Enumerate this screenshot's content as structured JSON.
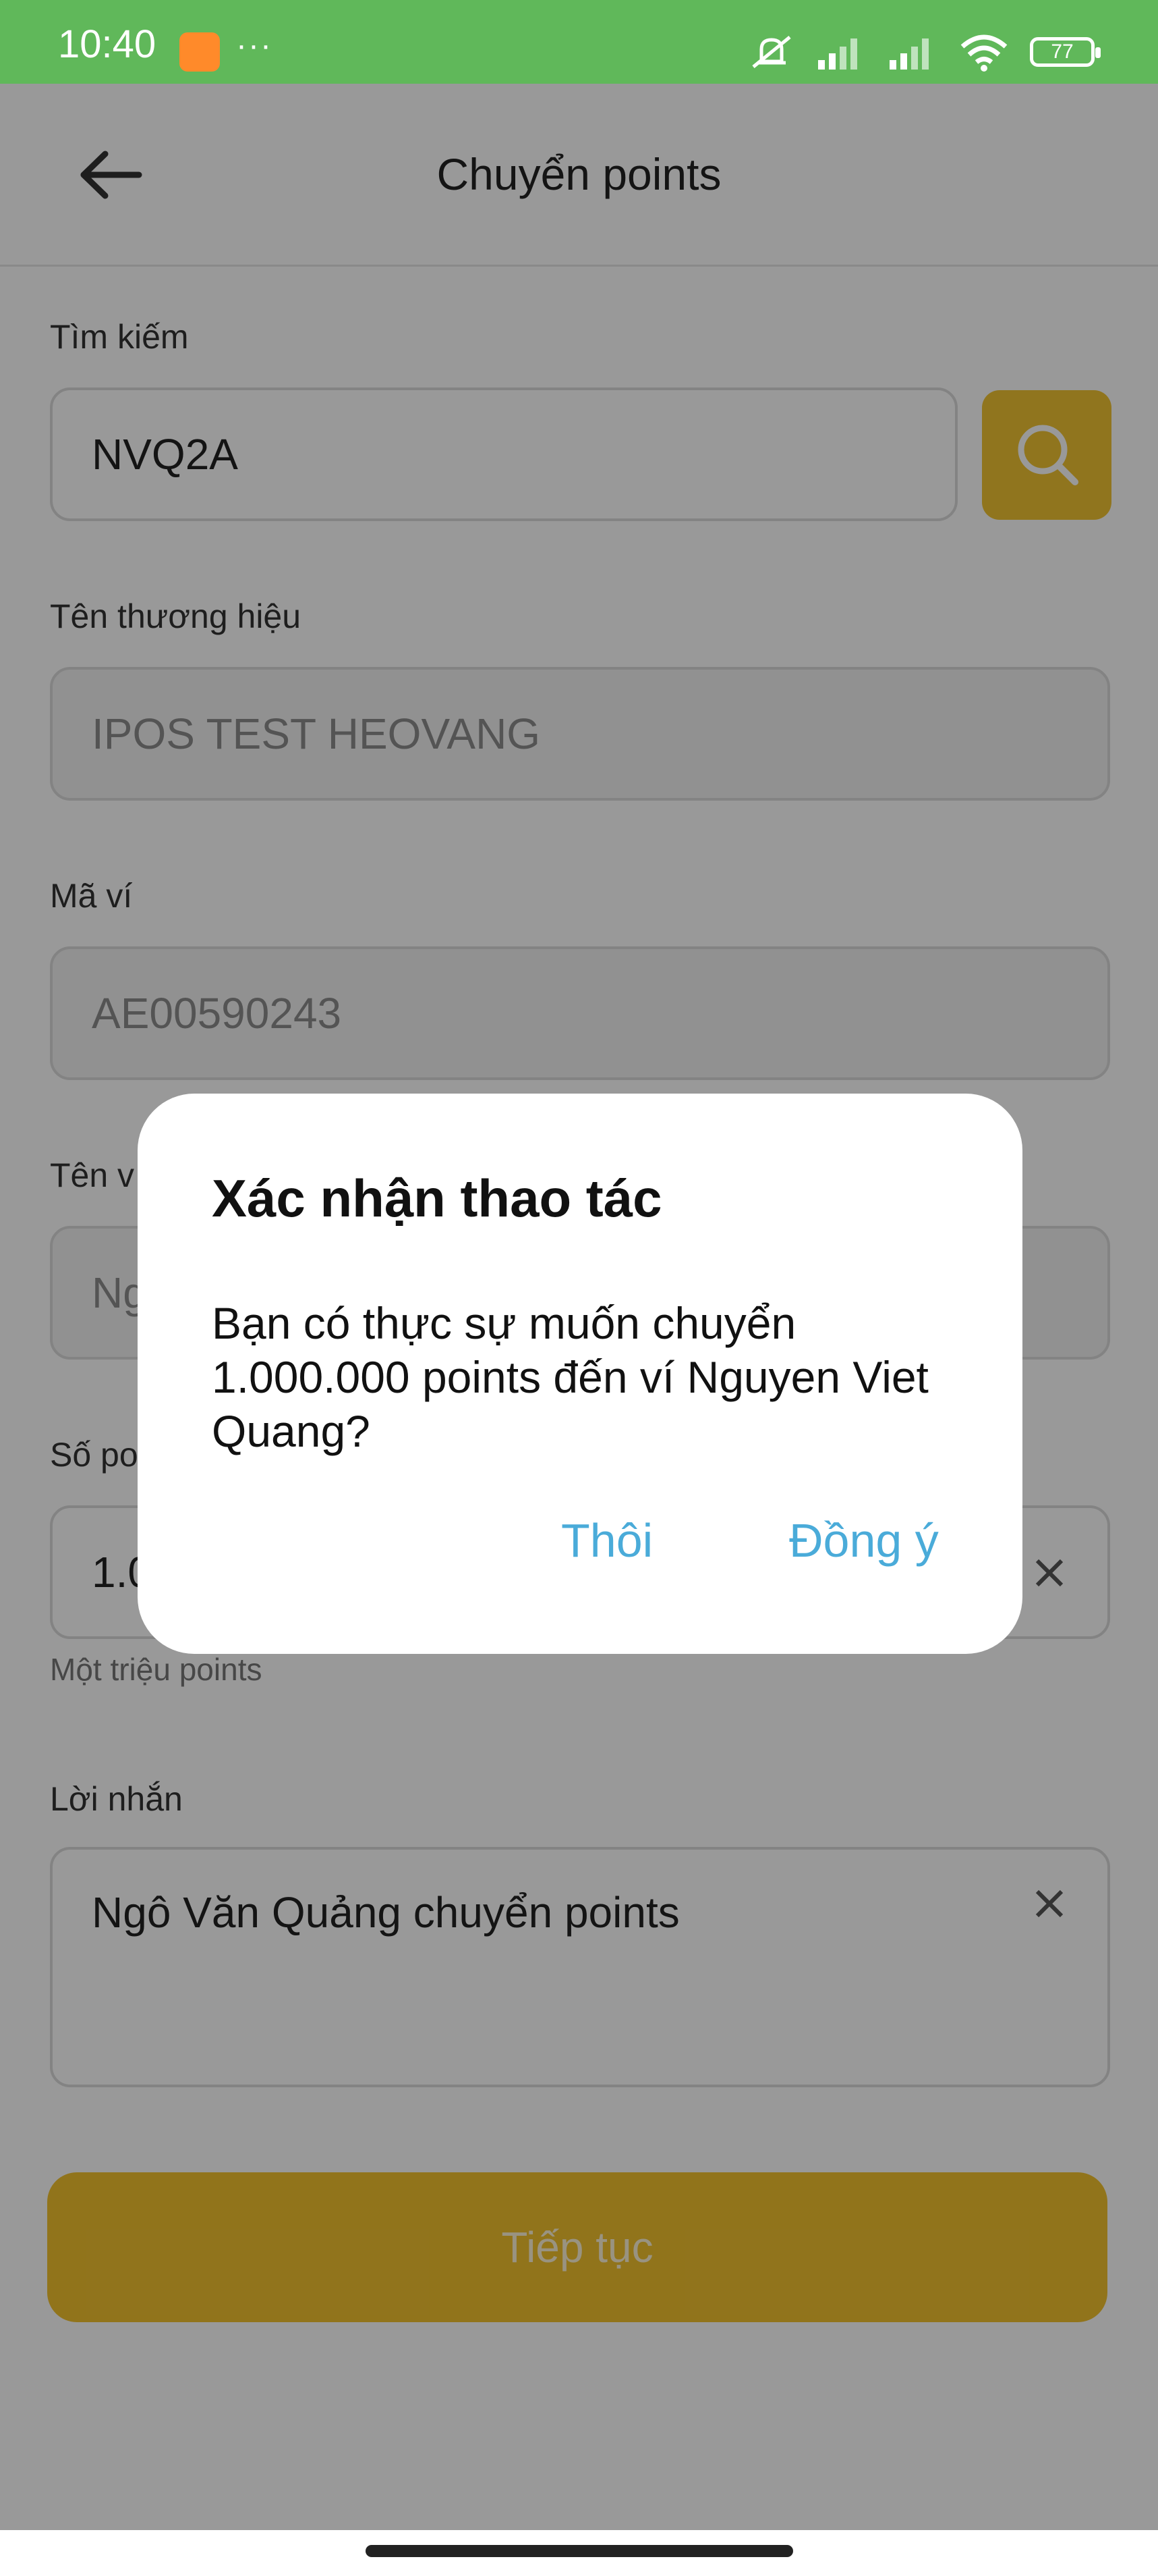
{
  "status_bar": {
    "time": "10:40",
    "dots": "···",
    "battery": "77",
    "icons": [
      "silent-icon",
      "signal-icon",
      "signal-icon",
      "wifi-icon",
      "battery-icon"
    ]
  },
  "header": {
    "title": "Chuyển points"
  },
  "form": {
    "search": {
      "label": "Tìm kiếm",
      "value": "NVQ2A"
    },
    "brand": {
      "label": "Tên thương hiệu",
      "value": "IPOS TEST HEOVANG"
    },
    "wallet_code": {
      "label": "Mã ví",
      "value": "AE00590243"
    },
    "wallet_name": {
      "label": "Tên v",
      "value": "Ng"
    },
    "points": {
      "label": "Số po",
      "value": "1.0",
      "hint": "Một triệu points"
    },
    "message": {
      "label": "Lời nhắn",
      "value": "Ngô Văn Quảng chuyển points"
    },
    "continue_label": "Tiếp tục"
  },
  "dialog": {
    "title": "Xác nhận thao tác",
    "message": "Bạn có thực sự muốn chuyển 1.000.000 points đến ví Nguyen Viet Quang?",
    "cancel_label": "Thôi",
    "confirm_label": "Đồng ý"
  },
  "colors": {
    "status_bar": "#60b85a",
    "accent": "#f2c12e",
    "dialog_button": "#4aabd9"
  }
}
